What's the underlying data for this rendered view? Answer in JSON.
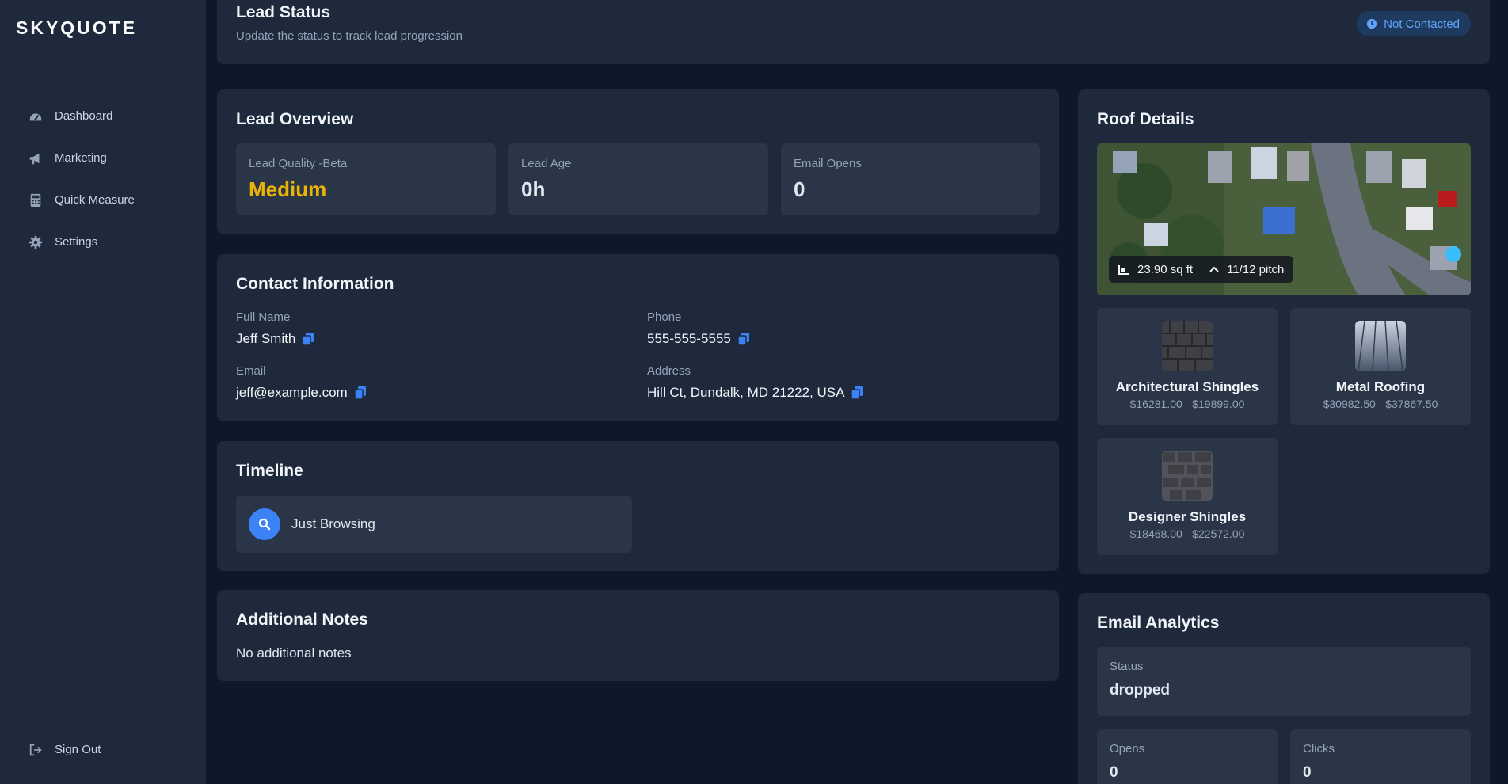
{
  "brand": {
    "logo": "SKYQUOTE"
  },
  "nav": {
    "items": [
      {
        "label": "Dashboard",
        "icon": "dashboard-icon"
      },
      {
        "label": "Marketing",
        "icon": "megaphone-icon"
      },
      {
        "label": "Quick Measure",
        "icon": "calculator-icon"
      },
      {
        "label": "Settings",
        "icon": "gear-icon"
      }
    ],
    "signout": "Sign Out"
  },
  "lead_status": {
    "title": "Lead Status",
    "subtitle": "Update the status to track lead progression",
    "badge": "Not Contacted"
  },
  "overview": {
    "title": "Lead Overview",
    "stats": [
      {
        "label": "Lead Quality -Beta",
        "value": "Medium"
      },
      {
        "label": "Lead Age",
        "value": "0h"
      },
      {
        "label": "Email Opens",
        "value": "0"
      }
    ]
  },
  "contact": {
    "title": "Contact Information",
    "full_name_label": "Full Name",
    "full_name": "Jeff Smith",
    "phone_label": "Phone",
    "phone": "555-555-5555",
    "email_label": "Email",
    "email": "jeff@example.com",
    "address_label": "Address",
    "address": "Hill Ct, Dundalk, MD 21222, USA"
  },
  "timeline": {
    "title": "Timeline",
    "item": "Just Browsing"
  },
  "notes": {
    "title": "Additional Notes",
    "text": "No additional notes"
  },
  "roof": {
    "title": "Roof Details",
    "area": "23.90 sq ft",
    "pitch": "11/12 pitch",
    "materials": [
      {
        "name": "Architectural Shingles",
        "price": "$16281.00 - $19899.00"
      },
      {
        "name": "Metal Roofing",
        "price": "$30982.50 - $37867.50"
      },
      {
        "name": "Designer Shingles",
        "price": "$18468.00 - $22572.00"
      }
    ]
  },
  "email_analytics": {
    "title": "Email Analytics",
    "status_label": "Status",
    "status": "dropped",
    "opens_label": "Opens",
    "opens": "0",
    "clicks_label": "Clicks",
    "clicks": "0"
  },
  "colors": {
    "background": "#0f172a",
    "card": "#1e293b",
    "accent": "#3b82f6",
    "quality_medium": "#eab308"
  }
}
